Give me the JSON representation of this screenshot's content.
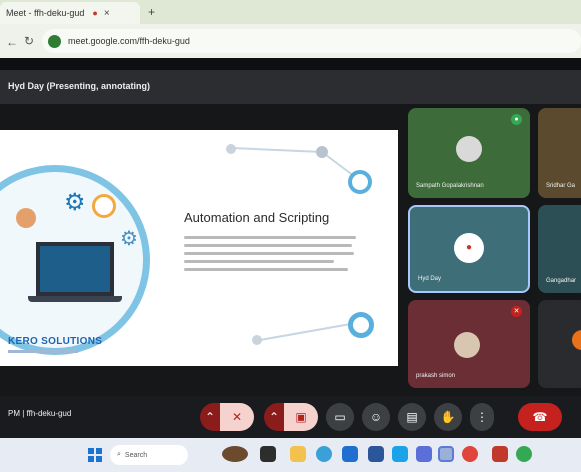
{
  "browser": {
    "tab_title": "Meet - ffh-deku-gud",
    "tab_recording_icon": "recording-dot-icon",
    "tab_close_icon": "close-icon",
    "new_tab_glyph": "+",
    "back_glyph": "←",
    "reload_glyph": "↻",
    "url": "meet.google.com/ffh-deku-gud"
  },
  "meet": {
    "presenter_title": "Hyd Day (Presenting, annotating)",
    "meeting_code": "PM  |  ffh-deku-gud"
  },
  "slide": {
    "title": "Automation and Scripting",
    "logo_text": "KERO SOLUTIONS",
    "accent_color": "#7fc4e4"
  },
  "participants": [
    {
      "name": "Sampath Gopalakrishnan",
      "bg": "#3d6b3a",
      "badge": "mic-active-icon"
    },
    {
      "name": "Sridhar Ga",
      "bg": "#5c4a2e",
      "badge": ""
    },
    {
      "name": "Hyd Day",
      "bg": "#3e6f78",
      "badge": ""
    },
    {
      "name": "Gangadhar",
      "bg": "#2c4f55",
      "badge": ""
    },
    {
      "name": "prakash simon",
      "bg": "#6b2e35",
      "badge": "mic-muted-icon"
    },
    {
      "name": "",
      "bg": "#2a2b2e",
      "badge": ""
    }
  ],
  "toolbar": {
    "buttons": [
      {
        "name": "mic-menu-button",
        "icon": "chevron-up-icon",
        "glyph": "⌃"
      },
      {
        "name": "mic-toggle-button",
        "icon": "mic-off-icon",
        "glyph": "✕"
      },
      {
        "name": "camera-menu-button",
        "icon": "chevron-up-icon",
        "glyph": "⌃"
      },
      {
        "name": "camera-toggle-button",
        "icon": "camera-off-icon",
        "glyph": "▣"
      },
      {
        "name": "captions-button",
        "icon": "captions-icon",
        "glyph": "▭"
      },
      {
        "name": "emoji-button",
        "icon": "emoji-icon",
        "glyph": "☺"
      },
      {
        "name": "present-button",
        "icon": "present-icon",
        "glyph": "▤"
      },
      {
        "name": "raise-hand-button",
        "icon": "hand-icon",
        "glyph": "✋"
      },
      {
        "name": "more-options-button",
        "icon": "more-vert-icon",
        "glyph": "⋮"
      },
      {
        "name": "leave-call-button",
        "icon": "end-call-icon",
        "glyph": "☎"
      }
    ]
  },
  "taskbar": {
    "search_placeholder": "Search",
    "icons": [
      "file-explorer-icon",
      "edge-icon",
      "chrome-icon",
      "mail-icon",
      "store-icon",
      "teams-icon",
      "photos-icon",
      "settings-icon"
    ]
  },
  "colors": {
    "danger": "#c5221f",
    "control": "#3c4043",
    "tile_active_border": "#a8c7fa"
  }
}
